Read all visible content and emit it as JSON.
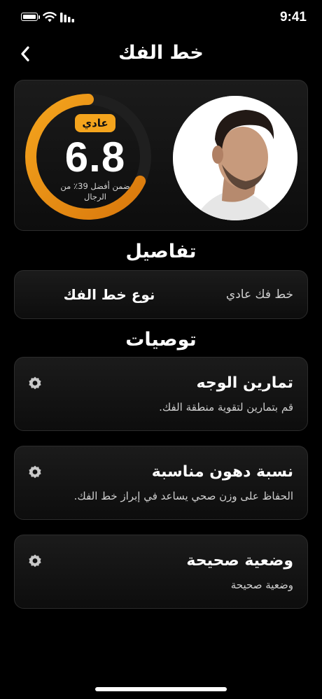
{
  "status_bar": {
    "time": "9:41"
  },
  "nav": {
    "title": "خط الفك",
    "back_icon": "chevron-left-icon"
  },
  "score": {
    "badge": "عادي",
    "value": "6.8",
    "subtitle": "ضمن أفضل 39٪ من الرجال",
    "progress_percent": 68,
    "accent_color": "#f4a41d",
    "accent_dark": "#d9780c"
  },
  "details": {
    "heading": "تفاصيل",
    "label": "نوع خط الفك",
    "value": "خط فك عادي"
  },
  "recommendations": {
    "heading": "توصيات",
    "items": [
      {
        "title": "تمارين الوجه",
        "description": "قم بتمارين لتقوية منطقة الفك.",
        "icon": "gear-icon"
      },
      {
        "title": "نسبة دهون مناسبة",
        "description": "الحفاظ على وزن صحي يساعد في إبراز خط الفك.",
        "icon": "gear-icon"
      },
      {
        "title": "وضعية صحيحة",
        "description": "وضعية صحيحة",
        "icon": "gear-icon"
      }
    ]
  }
}
